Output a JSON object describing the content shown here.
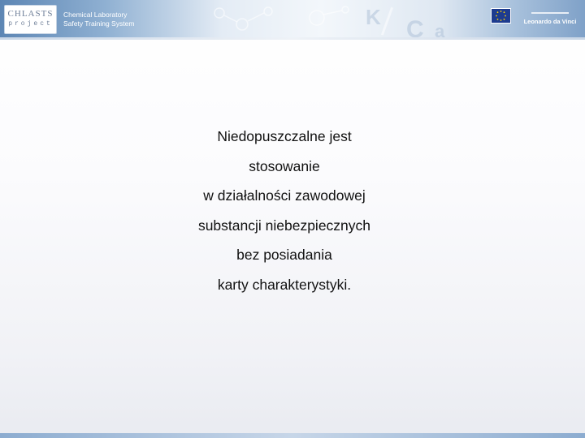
{
  "header": {
    "logo_line1": "CHLASTS",
    "logo_line2": "project",
    "title_line1": "Chemical Laboratory",
    "title_line2": "Safety Training System",
    "partner_label": "Leonardo da Vinci",
    "eu_flag_icon": "eu-flag-icon",
    "colors": {
      "banner_dark": "#5d86b4",
      "banner_light": "#f3f7fb",
      "flag": "#1d3b8f"
    }
  },
  "slide": {
    "lines": [
      "Niedopuszczalne jest",
      "stosowanie",
      "w działalności zawodowej",
      "substancji niebezpiecznych",
      "bez posiadania",
      "karty charakterystyki."
    ]
  }
}
